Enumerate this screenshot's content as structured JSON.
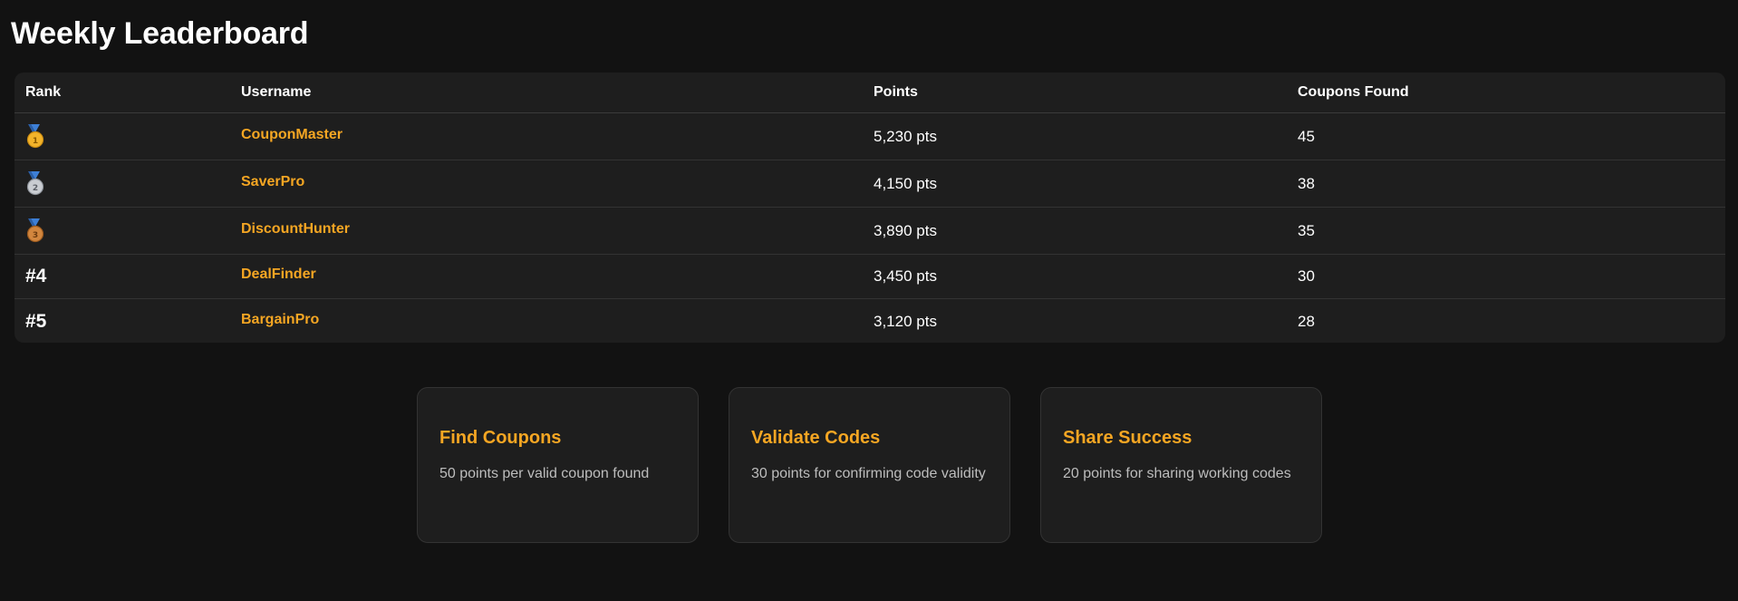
{
  "page": {
    "title": "Weekly Leaderboard"
  },
  "leaderboard": {
    "columns": {
      "rank": "Rank",
      "username": "Username",
      "points": "Points",
      "coupons": "Coupons Found"
    },
    "rows": [
      {
        "rank_icon": "gold-medal-icon",
        "rank_text": "",
        "username": "CouponMaster",
        "points": "5,230 pts",
        "coupons": "45"
      },
      {
        "rank_icon": "silver-medal-icon",
        "rank_text": "",
        "username": "SaverPro",
        "points": "4,150 pts",
        "coupons": "38"
      },
      {
        "rank_icon": "bronze-medal-icon",
        "rank_text": "",
        "username": "DiscountHunter",
        "points": "3,890 pts",
        "coupons": "35"
      },
      {
        "rank_icon": "",
        "rank_text": "#4",
        "username": "DealFinder",
        "points": "3,450 pts",
        "coupons": "30"
      },
      {
        "rank_icon": "",
        "rank_text": "#5",
        "username": "BargainPro",
        "points": "3,120 pts",
        "coupons": "28"
      }
    ]
  },
  "cards": [
    {
      "title": "Find Coupons",
      "description": "50 points per valid coupon found"
    },
    {
      "title": "Validate Codes",
      "description": "30 points for confirming code validity"
    },
    {
      "title": "Share Success",
      "description": "20 points for sharing working codes"
    }
  ],
  "colors": {
    "background": "#121212",
    "surface": "#1e1e1e",
    "accent": "#f5a623",
    "gold": "#f2b32a",
    "silver": "#c9ccd1",
    "bronze": "#d2863e",
    "ribbon": "#3d7fd6"
  }
}
